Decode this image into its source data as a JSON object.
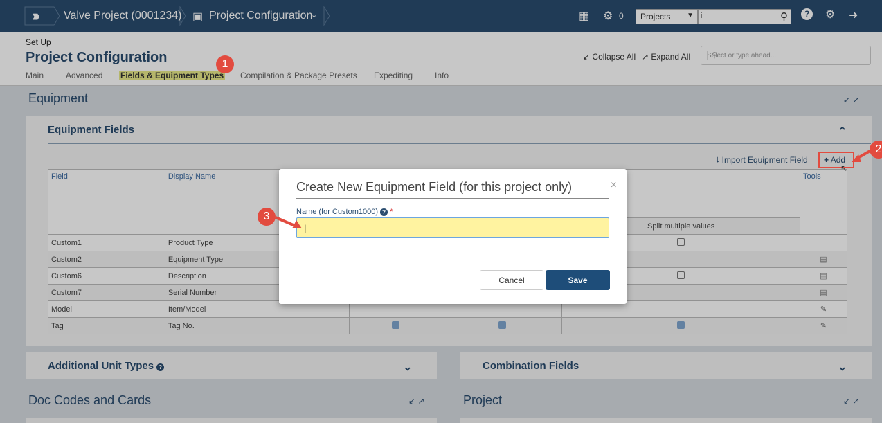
{
  "topbar": {
    "project": "Valve Project (0001234)",
    "page": "Project Configuration",
    "counter": "0",
    "scope_select": "Projects",
    "search_info_glyph": "i"
  },
  "header": {
    "section": "Set Up",
    "title": "Project Configuration",
    "tabs": [
      "Main",
      "Advanced",
      "Fields & Equipment Types",
      "Compilation & Package Presets",
      "Expediting",
      "Info"
    ],
    "collapse_all": "Collapse All",
    "expand_all": "Expand All",
    "search_placeholder": "Select or type ahead..."
  },
  "equipment": {
    "section_title": "Equipment",
    "panel_title": "Equipment Fields",
    "import_label": "Import Equipment Field",
    "add_label": "Add",
    "columns": {
      "field": "Field",
      "display_name": "Display Name",
      "tools": "Tools",
      "split": "Split multiple values"
    },
    "rows": [
      {
        "field": "Custom1",
        "display": "Product Type"
      },
      {
        "field": "Custom2",
        "display": "Equipment Type"
      },
      {
        "field": "Custom6",
        "display": "Description"
      },
      {
        "field": "Custom7",
        "display": "Serial Number"
      },
      {
        "field": "Model",
        "display": "Item/Model"
      },
      {
        "field": "Tag",
        "display": "Tag No."
      }
    ]
  },
  "lower": {
    "additional_unit_types": "Additional Unit Types",
    "combination_fields": "Combination Fields",
    "doc_codes": "Doc Codes and Cards",
    "project": "Project"
  },
  "modal": {
    "title": "Create New Equipment Field (for this project only)",
    "field_label": "Name (for Custom1000)",
    "required_mark": "*",
    "cancel": "Cancel",
    "save": "Save",
    "close": "×"
  },
  "annotations": {
    "step1": "1",
    "step2": "2",
    "step3": "3"
  },
  "colors": {
    "brand": "#2a4c6f",
    "annotation": "#e24b3f",
    "highlight": "#fff3a0"
  }
}
